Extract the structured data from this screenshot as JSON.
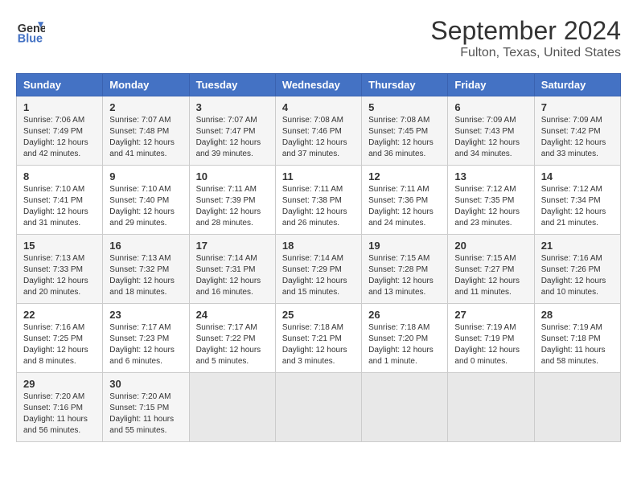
{
  "logo": {
    "line1": "General",
    "line2": "Blue"
  },
  "title": "September 2024",
  "subtitle": "Fulton, Texas, United States",
  "days_of_week": [
    "Sunday",
    "Monday",
    "Tuesday",
    "Wednesday",
    "Thursday",
    "Friday",
    "Saturday"
  ],
  "weeks": [
    [
      {
        "num": "1",
        "rise": "7:06 AM",
        "set": "7:49 PM",
        "daylight": "12 hours and 42 minutes."
      },
      {
        "num": "2",
        "rise": "7:07 AM",
        "set": "7:48 PM",
        "daylight": "12 hours and 41 minutes."
      },
      {
        "num": "3",
        "rise": "7:07 AM",
        "set": "7:47 PM",
        "daylight": "12 hours and 39 minutes."
      },
      {
        "num": "4",
        "rise": "7:08 AM",
        "set": "7:46 PM",
        "daylight": "12 hours and 37 minutes."
      },
      {
        "num": "5",
        "rise": "7:08 AM",
        "set": "7:45 PM",
        "daylight": "12 hours and 36 minutes."
      },
      {
        "num": "6",
        "rise": "7:09 AM",
        "set": "7:43 PM",
        "daylight": "12 hours and 34 minutes."
      },
      {
        "num": "7",
        "rise": "7:09 AM",
        "set": "7:42 PM",
        "daylight": "12 hours and 33 minutes."
      }
    ],
    [
      {
        "num": "8",
        "rise": "7:10 AM",
        "set": "7:41 PM",
        "daylight": "12 hours and 31 minutes."
      },
      {
        "num": "9",
        "rise": "7:10 AM",
        "set": "7:40 PM",
        "daylight": "12 hours and 29 minutes."
      },
      {
        "num": "10",
        "rise": "7:11 AM",
        "set": "7:39 PM",
        "daylight": "12 hours and 28 minutes."
      },
      {
        "num": "11",
        "rise": "7:11 AM",
        "set": "7:38 PM",
        "daylight": "12 hours and 26 minutes."
      },
      {
        "num": "12",
        "rise": "7:11 AM",
        "set": "7:36 PM",
        "daylight": "12 hours and 24 minutes."
      },
      {
        "num": "13",
        "rise": "7:12 AM",
        "set": "7:35 PM",
        "daylight": "12 hours and 23 minutes."
      },
      {
        "num": "14",
        "rise": "7:12 AM",
        "set": "7:34 PM",
        "daylight": "12 hours and 21 minutes."
      }
    ],
    [
      {
        "num": "15",
        "rise": "7:13 AM",
        "set": "7:33 PM",
        "daylight": "12 hours and 20 minutes."
      },
      {
        "num": "16",
        "rise": "7:13 AM",
        "set": "7:32 PM",
        "daylight": "12 hours and 18 minutes."
      },
      {
        "num": "17",
        "rise": "7:14 AM",
        "set": "7:31 PM",
        "daylight": "12 hours and 16 minutes."
      },
      {
        "num": "18",
        "rise": "7:14 AM",
        "set": "7:29 PM",
        "daylight": "12 hours and 15 minutes."
      },
      {
        "num": "19",
        "rise": "7:15 AM",
        "set": "7:28 PM",
        "daylight": "12 hours and 13 minutes."
      },
      {
        "num": "20",
        "rise": "7:15 AM",
        "set": "7:27 PM",
        "daylight": "12 hours and 11 minutes."
      },
      {
        "num": "21",
        "rise": "7:16 AM",
        "set": "7:26 PM",
        "daylight": "12 hours and 10 minutes."
      }
    ],
    [
      {
        "num": "22",
        "rise": "7:16 AM",
        "set": "7:25 PM",
        "daylight": "12 hours and 8 minutes."
      },
      {
        "num": "23",
        "rise": "7:17 AM",
        "set": "7:23 PM",
        "daylight": "12 hours and 6 minutes."
      },
      {
        "num": "24",
        "rise": "7:17 AM",
        "set": "7:22 PM",
        "daylight": "12 hours and 5 minutes."
      },
      {
        "num": "25",
        "rise": "7:18 AM",
        "set": "7:21 PM",
        "daylight": "12 hours and 3 minutes."
      },
      {
        "num": "26",
        "rise": "7:18 AM",
        "set": "7:20 PM",
        "daylight": "12 hours and 1 minute."
      },
      {
        "num": "27",
        "rise": "7:19 AM",
        "set": "7:19 PM",
        "daylight": "12 hours and 0 minutes."
      },
      {
        "num": "28",
        "rise": "7:19 AM",
        "set": "7:18 PM",
        "daylight": "11 hours and 58 minutes."
      }
    ],
    [
      {
        "num": "29",
        "rise": "7:20 AM",
        "set": "7:16 PM",
        "daylight": "11 hours and 56 minutes."
      },
      {
        "num": "30",
        "rise": "7:20 AM",
        "set": "7:15 PM",
        "daylight": "11 hours and 55 minutes."
      },
      null,
      null,
      null,
      null,
      null
    ]
  ]
}
